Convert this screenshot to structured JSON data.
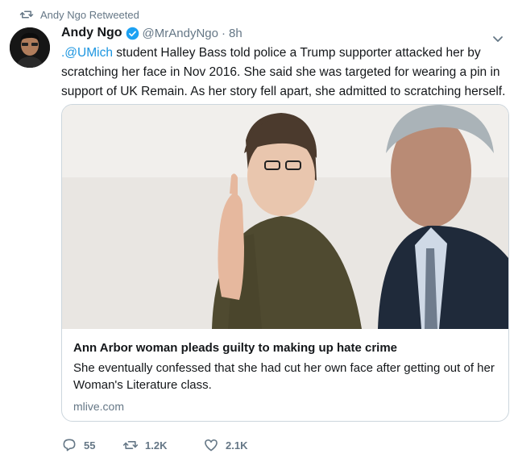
{
  "retweet_notice": "Andy Ngo Retweeted",
  "author": {
    "name": "Andy Ngo",
    "handle": "@MrAndyNgo",
    "separator": "·",
    "time": "8h"
  },
  "tweet": {
    "mention": ".@UMich",
    "body": " student Halley Bass told police a Trump supporter attacked her by scratching her face in Nov 2016. She said she was targeted for wearing a pin in support of UK Remain. As her story fell apart, she admitted to scratching herself."
  },
  "card": {
    "title": "Ann Arbor woman pleads guilty to making up hate crime",
    "description": "She eventually confessed that she had cut her own face after getting out of her Woman's Literature class.",
    "domain": "mlive.com"
  },
  "actions": {
    "replies": "55",
    "retweets": "1.2K",
    "likes": "2.1K"
  },
  "colors": {
    "link": "#1b95e0",
    "secondary_text": "#657786",
    "verified": "#1da1f2"
  },
  "icons": [
    "retweet-icon",
    "verified-badge-icon",
    "chevron-down-icon",
    "reply-icon",
    "like-icon"
  ]
}
